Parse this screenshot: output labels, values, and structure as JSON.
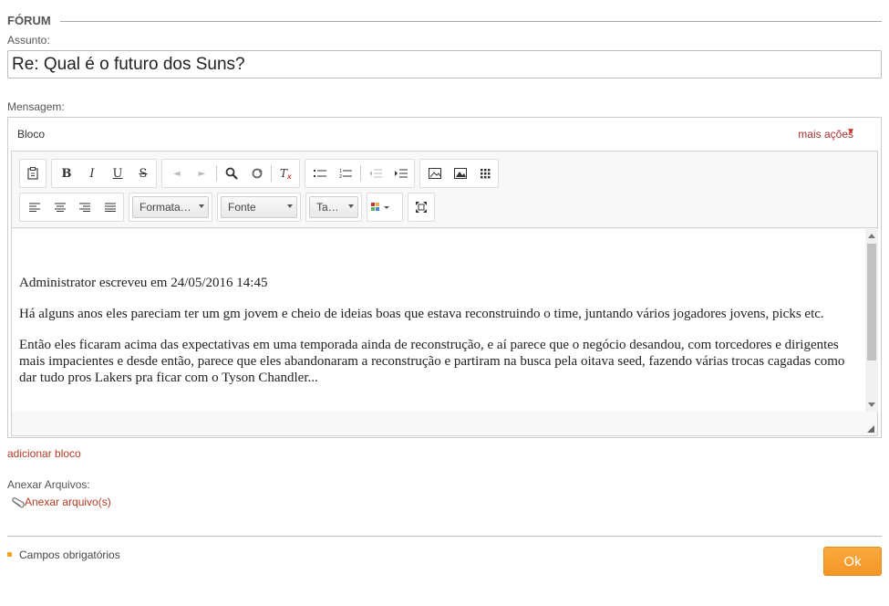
{
  "section_title": "FÓRUM",
  "subject": {
    "label": "Assunto:",
    "value": "Re: Qual é o futuro dos Suns?"
  },
  "message": {
    "label": "Mensagem:"
  },
  "block": {
    "name": "Bloco",
    "more_actions": "mais ações",
    "more_arrow": "▼"
  },
  "toolbar": {
    "format_combo": "Formata…",
    "font_combo": "Fonte",
    "size_combo": "Ta…"
  },
  "editor_content": {
    "quote_header": "Administrator escreveu em 24/05/2016 14:45",
    "paragraph_1": "Há alguns anos eles pareciam ter um gm jovem e cheio de ideias boas que estava reconstruindo o time, juntando vários jogadores jovens, picks etc.",
    "paragraph_2": "Então eles ficaram acima das expectativas em uma temporada ainda de reconstrução, e aí parece que o negócio desandou, com torcedores e dirigentes mais impacientes e desde então, parece que eles abandonaram a reconstrução e partiram na busca pela oitava seed, fazendo várias trocas cagadas como dar tudo pros Lakers pra ficar com o Tyson Chandler..."
  },
  "add_block": "adicionar bloco",
  "attachments": {
    "label": "Anexar Arquivos:",
    "link": "Anexar arquivo(s)"
  },
  "required_fields": "Campos obrigatórios",
  "ok_button": "Ok",
  "colors": {
    "accent": "#f59626",
    "link": "#b33b24"
  }
}
